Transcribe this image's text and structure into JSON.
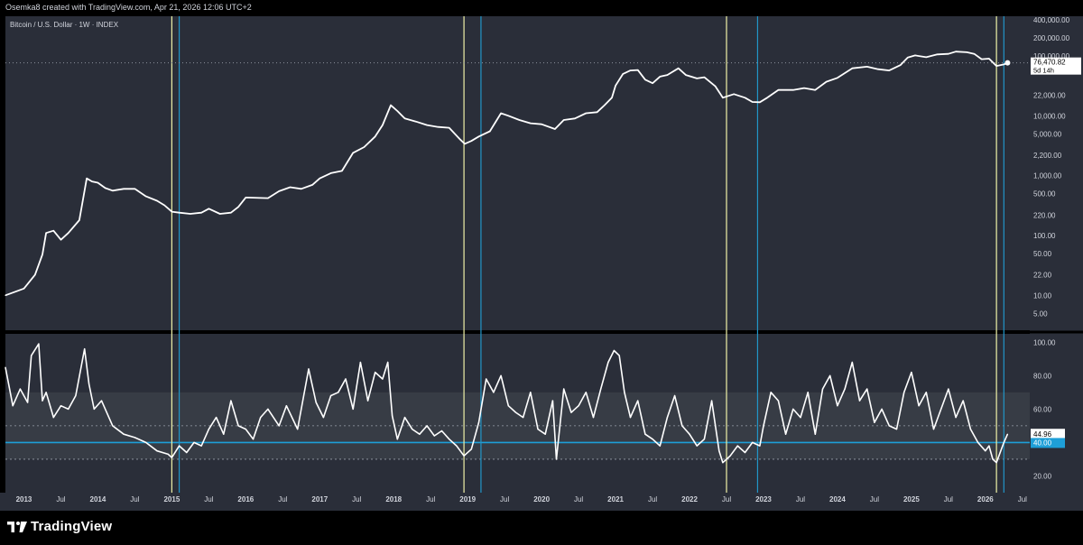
{
  "credit": "Osemka8 created with TradingView.com, Apr 21, 2026 12:06 UTC+2",
  "brand": "TradingView",
  "colors": {
    "background": "#2a2e39",
    "price_line": "#ffffff",
    "yellow_line": "#f0f2a8",
    "blue_line": "#2196c8",
    "band": "#3a3e48",
    "level_line": "#1e9fd8"
  },
  "chart_data": [
    {
      "type": "line",
      "title": "Bitcoin / U.S. Dollar · 1W · INDEX",
      "scale": "log",
      "ylim": [
        3,
        400000
      ],
      "yticks": [
        {
          "v": 400000,
          "label": "400,000.00"
        },
        {
          "v": 200000,
          "label": "200,000.00"
        },
        {
          "v": 100000,
          "label": "100,000.00"
        },
        {
          "v": 22000,
          "label": "22,000.00"
        },
        {
          "v": 10000,
          "label": "10,000.00"
        },
        {
          "v": 5000,
          "label": "5,000.00"
        },
        {
          "v": 2200,
          "label": "2,200.00"
        },
        {
          "v": 1000,
          "label": "1,000.00"
        },
        {
          "v": 500,
          "label": "500.00"
        },
        {
          "v": 220,
          "label": "220.00"
        },
        {
          "v": 100,
          "label": "100.00"
        },
        {
          "v": 50,
          "label": "50.00"
        },
        {
          "v": 22,
          "label": "22.00"
        },
        {
          "v": 10,
          "label": "10.00"
        },
        {
          "v": 5,
          "label": "5.00"
        }
      ],
      "last_price": {
        "value": 76470.82,
        "label": "76,470.82",
        "countdown": "5d 14h"
      },
      "x": [
        2012.75,
        2013.0,
        2013.15,
        2013.25,
        2013.3,
        2013.4,
        2013.5,
        2013.6,
        2013.75,
        2013.85,
        2013.92,
        2014.0,
        2014.1,
        2014.2,
        2014.35,
        2014.5,
        2014.65,
        2014.8,
        2014.9,
        2015.0,
        2015.1,
        2015.25,
        2015.4,
        2015.5,
        2015.65,
        2015.8,
        2015.9,
        2016.0,
        2016.3,
        2016.45,
        2016.6,
        2016.75,
        2016.9,
        2017.0,
        2017.15,
        2017.3,
        2017.45,
        2017.6,
        2017.75,
        2017.85,
        2017.96,
        2018.05,
        2018.15,
        2018.3,
        2018.45,
        2018.6,
        2018.75,
        2018.9,
        2018.96,
        2019.05,
        2019.15,
        2019.3,
        2019.45,
        2019.55,
        2019.7,
        2019.85,
        2020.0,
        2020.18,
        2020.3,
        2020.45,
        2020.6,
        2020.75,
        2020.85,
        2020.95,
        2021.0,
        2021.1,
        2021.2,
        2021.3,
        2021.4,
        2021.5,
        2021.6,
        2021.7,
        2021.85,
        2021.95,
        2022.1,
        2022.2,
        2022.35,
        2022.45,
        2022.6,
        2022.75,
        2022.85,
        2022.95,
        2023.05,
        2023.2,
        2023.4,
        2023.55,
        2023.7,
        2023.85,
        2024.0,
        2024.2,
        2024.4,
        2024.55,
        2024.7,
        2024.85,
        2024.95,
        2025.05,
        2025.2,
        2025.35,
        2025.5,
        2025.6,
        2025.75,
        2025.85,
        2025.95,
        2026.05,
        2026.15,
        2026.25,
        2026.3
      ],
      "y": [
        10,
        13,
        22,
        48,
        110,
        120,
        85,
        110,
        180,
        900,
        800,
        760,
        620,
        560,
        600,
        600,
        450,
        380,
        320,
        250,
        240,
        230,
        240,
        280,
        230,
        240,
        300,
        430,
        420,
        550,
        640,
        600,
        700,
        900,
        1100,
        1200,
        2400,
        3000,
        4500,
        7000,
        15000,
        12000,
        9000,
        8000,
        7000,
        6500,
        6300,
        4000,
        3400,
        3800,
        4500,
        5500,
        11000,
        10000,
        8500,
        7500,
        7200,
        6000,
        8500,
        9000,
        11000,
        11500,
        15000,
        20000,
        32000,
        50000,
        57000,
        58000,
        40000,
        35000,
        45000,
        48000,
        62000,
        48000,
        42000,
        44000,
        31000,
        20000,
        23000,
        20000,
        17000,
        16800,
        20000,
        27000,
        27000,
        29000,
        27000,
        37000,
        43000,
        62000,
        66000,
        60000,
        57000,
        70000,
        94000,
        102000,
        95000,
        106000,
        108000,
        118000,
        115000,
        108000,
        88000,
        90000,
        68000,
        72000,
        76470.82
      ]
    },
    {
      "type": "line",
      "ylim": [
        10,
        105
      ],
      "yticks": [
        {
          "v": 100,
          "label": "100.00"
        },
        {
          "v": 80,
          "label": "80.00"
        },
        {
          "v": 60,
          "label": "60.00"
        },
        {
          "v": 40,
          "label": "40.00"
        },
        {
          "v": 20,
          "label": "20.00"
        }
      ],
      "band": [
        30,
        70
      ],
      "levels": [
        50,
        40,
        30
      ],
      "current": {
        "value": 44.96,
        "label": "44.96"
      },
      "level_label": "40.00",
      "x": [
        2012.75,
        2012.85,
        2012.95,
        2013.05,
        2013.1,
        2013.2,
        2013.25,
        2013.3,
        2013.4,
        2013.5,
        2013.6,
        2013.7,
        2013.82,
        2013.88,
        2013.95,
        2014.05,
        2014.2,
        2014.35,
        2014.5,
        2014.65,
        2014.8,
        2014.95,
        2015.0,
        2015.1,
        2015.2,
        2015.3,
        2015.4,
        2015.5,
        2015.6,
        2015.7,
        2015.8,
        2015.9,
        2016.0,
        2016.1,
        2016.2,
        2016.3,
        2016.45,
        2016.55,
        2016.7,
        2016.85,
        2016.95,
        2017.05,
        2017.15,
        2017.25,
        2017.35,
        2017.45,
        2017.55,
        2017.65,
        2017.75,
        2017.85,
        2017.92,
        2017.98,
        2018.05,
        2018.15,
        2018.25,
        2018.35,
        2018.45,
        2018.55,
        2018.65,
        2018.75,
        2018.85,
        2018.95,
        2019.05,
        2019.15,
        2019.25,
        2019.35,
        2019.45,
        2019.55,
        2019.65,
        2019.75,
        2019.85,
        2019.95,
        2020.05,
        2020.15,
        2020.2,
        2020.3,
        2020.4,
        2020.5,
        2020.6,
        2020.7,
        2020.8,
        2020.9,
        2020.98,
        2021.05,
        2021.12,
        2021.2,
        2021.3,
        2021.4,
        2021.5,
        2021.6,
        2021.7,
        2021.8,
        2021.9,
        2022.0,
        2022.1,
        2022.2,
        2022.3,
        2022.4,
        2022.45,
        2022.55,
        2022.65,
        2022.75,
        2022.85,
        2022.95,
        2023.0,
        2023.1,
        2023.2,
        2023.3,
        2023.4,
        2023.5,
        2023.6,
        2023.7,
        2023.8,
        2023.9,
        2024.0,
        2024.1,
        2024.2,
        2024.3,
        2024.4,
        2024.5,
        2024.6,
        2024.7,
        2024.8,
        2024.9,
        2025.0,
        2025.1,
        2025.2,
        2025.3,
        2025.4,
        2025.5,
        2025.6,
        2025.7,
        2025.8,
        2025.9,
        2026.0,
        2026.05,
        2026.1,
        2026.15,
        2026.2,
        2026.25,
        2026.3
      ],
      "y": [
        85,
        62,
        72,
        64,
        92,
        99,
        65,
        70,
        55,
        62,
        60,
        68,
        96,
        75,
        60,
        65,
        50,
        45,
        43,
        40,
        35,
        33,
        31,
        38,
        34,
        40,
        38,
        48,
        55,
        45,
        65,
        50,
        48,
        42,
        55,
        60,
        50,
        62,
        48,
        84,
        64,
        55,
        68,
        70,
        78,
        60,
        88,
        65,
        82,
        78,
        88,
        56,
        42,
        55,
        48,
        45,
        50,
        44,
        47,
        42,
        38,
        32,
        36,
        52,
        78,
        70,
        80,
        62,
        58,
        55,
        70,
        48,
        45,
        65,
        30,
        72,
        58,
        62,
        70,
        55,
        72,
        88,
        95,
        92,
        70,
        55,
        65,
        45,
        42,
        38,
        55,
        68,
        50,
        45,
        38,
        42,
        65,
        35,
        28,
        32,
        38,
        34,
        40,
        38,
        50,
        70,
        65,
        45,
        60,
        55,
        70,
        45,
        72,
        80,
        62,
        72,
        88,
        65,
        72,
        52,
        60,
        50,
        48,
        70,
        82,
        62,
        70,
        48,
        60,
        72,
        55,
        65,
        48,
        40,
        35,
        38,
        30,
        28,
        34,
        40,
        44.96
      ]
    }
  ],
  "x_axis": {
    "range": [
      2012.75,
      2026.6
    ],
    "ticks": [
      {
        "v": 2013,
        "label": "2013"
      },
      {
        "v": 2013.5,
        "label": "Jul"
      },
      {
        "v": 2014,
        "label": "2014"
      },
      {
        "v": 2014.5,
        "label": "Jul"
      },
      {
        "v": 2015,
        "label": "2015"
      },
      {
        "v": 2015.5,
        "label": "Jul"
      },
      {
        "v": 2016,
        "label": "2016"
      },
      {
        "v": 2016.5,
        "label": "Jul"
      },
      {
        "v": 2017,
        "label": "2017"
      },
      {
        "v": 2017.5,
        "label": "Jul"
      },
      {
        "v": 2018,
        "label": "2018"
      },
      {
        "v": 2018.5,
        "label": "Jul"
      },
      {
        "v": 2019,
        "label": "2019"
      },
      {
        "v": 2019.5,
        "label": "Jul"
      },
      {
        "v": 2020,
        "label": "2020"
      },
      {
        "v": 2020.5,
        "label": "Jul"
      },
      {
        "v": 2021,
        "label": "2021"
      },
      {
        "v": 2021.5,
        "label": "Jul"
      },
      {
        "v": 2022,
        "label": "2022"
      },
      {
        "v": 2022.5,
        "label": "Jul"
      },
      {
        "v": 2023,
        "label": "2023"
      },
      {
        "v": 2023.5,
        "label": "Jul"
      },
      {
        "v": 2024,
        "label": "2024"
      },
      {
        "v": 2024.5,
        "label": "Jul"
      },
      {
        "v": 2025,
        "label": "2025"
      },
      {
        "v": 2025.5,
        "label": "Jul"
      },
      {
        "v": 2026,
        "label": "2026"
      },
      {
        "v": 2026.5,
        "label": "Jul"
      }
    ]
  },
  "vertical_markers": {
    "yellow": [
      2015.0,
      2018.95,
      2022.5,
      2026.15
    ],
    "blue": [
      2015.1,
      2019.18,
      2022.92,
      2026.25
    ]
  }
}
